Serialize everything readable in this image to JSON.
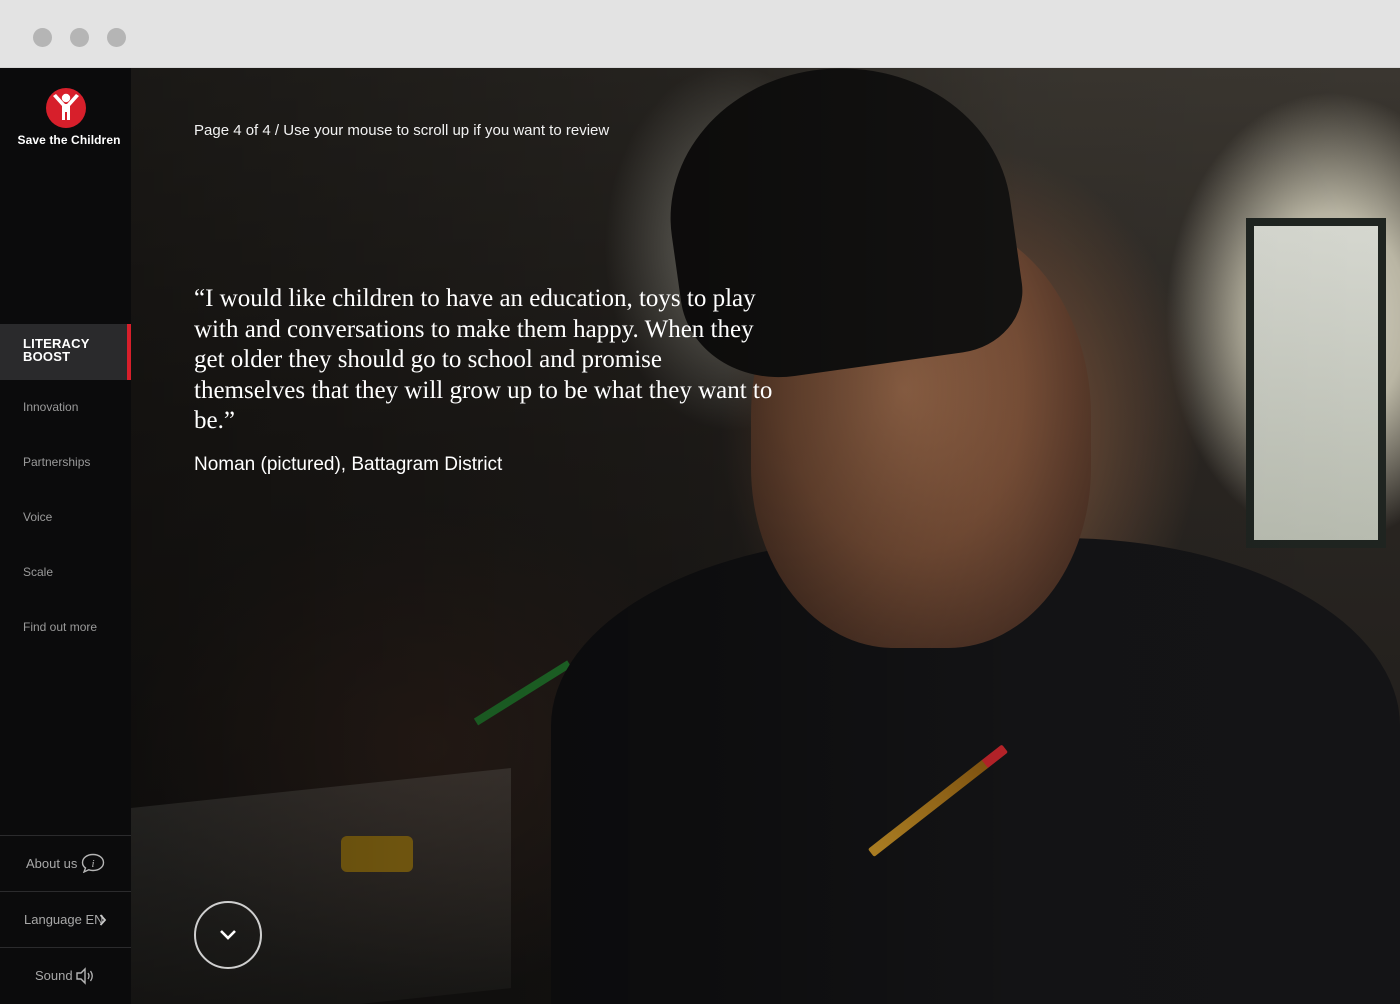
{
  "brand": {
    "name": "Save the Children",
    "color": "#d71f2b"
  },
  "sidebar": {
    "active": {
      "line1": "LITERACY",
      "line2": "BOOST"
    },
    "items": [
      {
        "label": "Innovation"
      },
      {
        "label": "Partnerships"
      },
      {
        "label": "Voice"
      },
      {
        "label": "Scale"
      },
      {
        "label": "Find out more"
      }
    ],
    "about_label": "About us",
    "about_icon": "info-speech-icon",
    "language_label": "Language EN",
    "language_icon": "chevron-right-icon",
    "sound_label": "Sound",
    "sound_icon": "speaker-icon"
  },
  "main": {
    "page_info": "Page 4 of 4 / Use your mouse to scroll up if you want to review",
    "quote": "“I would like children to have an education, toys to play with and conversations to make them happy. When they get older they should go to school and promise themselves that they will grow up to be what they want to be.”",
    "attribution": "Noman (pictured), Battagram District",
    "scroll_icon": "chevron-down-icon"
  }
}
